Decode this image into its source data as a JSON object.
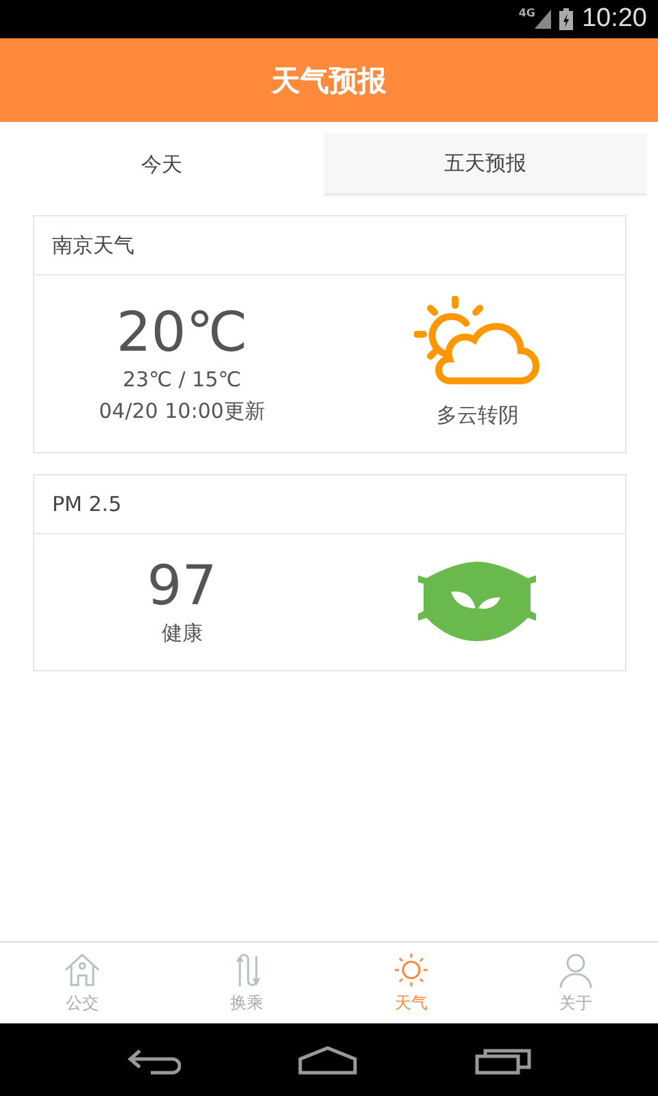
{
  "status_bar": {
    "network": "4G",
    "time": "10:20"
  },
  "header": {
    "title": "天气预报"
  },
  "tabs": [
    {
      "label": "今天",
      "selected": true
    },
    {
      "label": "五天预报",
      "selected": false
    }
  ],
  "weather_card": {
    "title": "南京天气",
    "temperature": "20℃",
    "range": "23℃ / 15℃",
    "updated": "04/20 10:00更新",
    "condition": "多云转阴"
  },
  "pm_card": {
    "title": "PM 2.5",
    "value": "97",
    "rating": "健康"
  },
  "bottom_nav": [
    {
      "kind": "house",
      "label": "公交",
      "selected": false
    },
    {
      "kind": "route",
      "label": "换乘",
      "selected": false
    },
    {
      "kind": "sun",
      "label": "天气",
      "selected": true
    },
    {
      "kind": "person",
      "label": "关于",
      "selected": false
    }
  ]
}
